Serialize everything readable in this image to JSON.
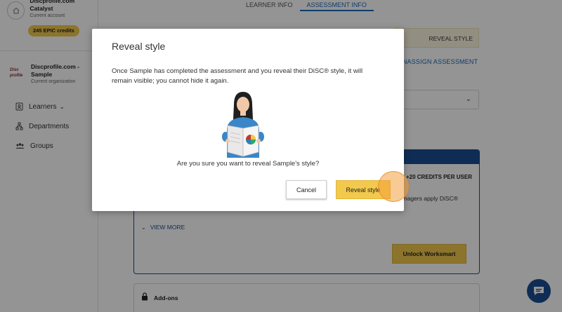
{
  "sidebar": {
    "account_name": "Discprofile.com Catalyst",
    "account_sub": "Current account",
    "credits": "245 EPIC credits",
    "org_logo": "Disc profile",
    "org_name": "Discprofile.com - Sample",
    "org_sub": "Current organization",
    "nav": [
      {
        "label": "Learners",
        "icon": "learners-icon"
      },
      {
        "label": "Departments",
        "icon": "departments-icon"
      },
      {
        "label": "Groups",
        "icon": "groups-icon"
      }
    ]
  },
  "tabs": [
    {
      "label": "LEARNER INFO",
      "active": false
    },
    {
      "label": "ASSESSMENT INFO",
      "active": true
    }
  ],
  "main": {
    "reveal_banner": "REVEAL STYLE",
    "unassign": "UNASSIGN ASSESSMENT",
    "worksmart": {
      "credits_per_user": "+20 CREDITS PER USER",
      "managers_text": "anagers apply DiSC®",
      "view_more": "VIEW MORE",
      "unlock": "Unlock Worksmart"
    },
    "addons": "Add-ons"
  },
  "modal": {
    "title": "Reveal style",
    "body": "Once Sample has completed the assessment and you reveal their DiSC® style, it will remain visible; you cannot hide it again.",
    "question": "Are you sure you want to reveal Sample's style?",
    "cancel": "Cancel",
    "reveal": "Reveal style"
  },
  "colors": {
    "accent_yellow": "#f2c94c",
    "brand_blue": "#1b4f91",
    "link_blue": "#1a66b8"
  }
}
